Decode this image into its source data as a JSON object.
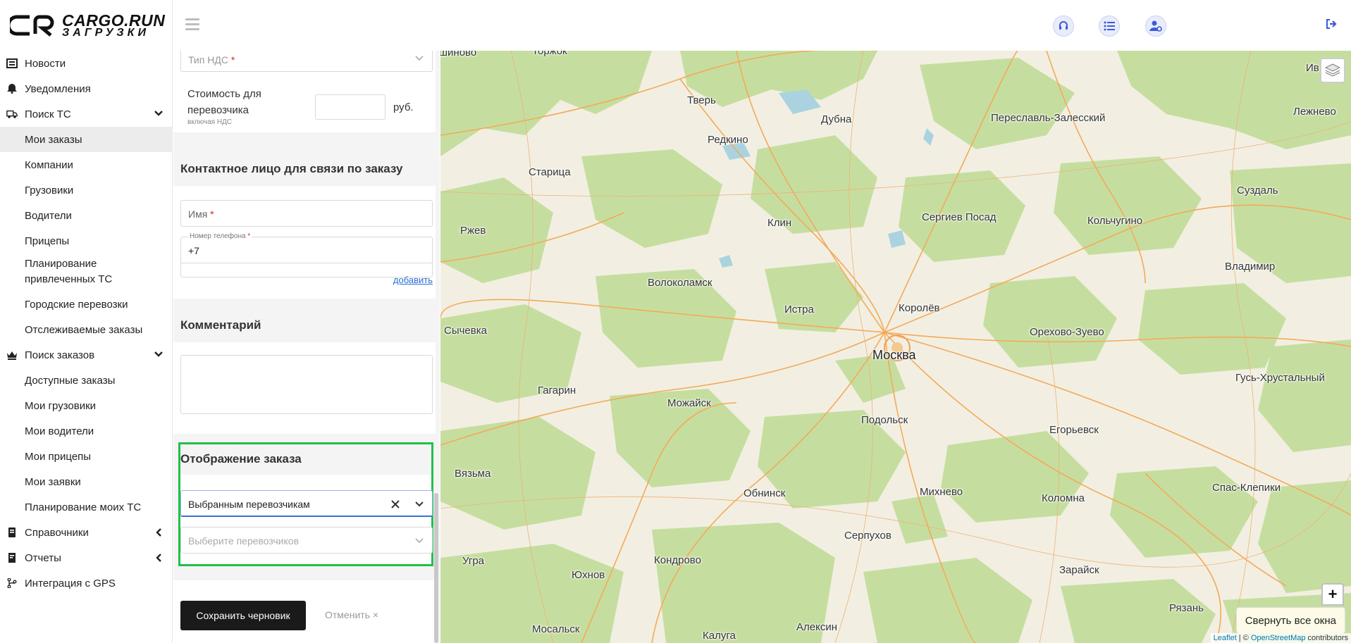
{
  "logo": {
    "line1": "CARGO.RUN",
    "line2": "ЗАГРУЗКИ"
  },
  "header": {
    "icons": [
      "headset-icon",
      "list-icon",
      "user-settings-icon"
    ],
    "logout_icon": "logout-icon"
  },
  "sidebar": {
    "items": [
      {
        "label": "Новости",
        "icon": "newspaper-icon"
      },
      {
        "label": "Уведомления",
        "icon": "bell-icon"
      },
      {
        "label": "Поиск ТС",
        "icon": "truck-icon",
        "chevron": "down"
      },
      {
        "label": "Мои заказы",
        "active": true
      },
      {
        "label": "Компании"
      },
      {
        "label": "Грузовики"
      },
      {
        "label": "Водители"
      },
      {
        "label": "Прицепы"
      },
      {
        "label": "Планирование привлеченных ТС"
      },
      {
        "label": "Городские перевозки"
      },
      {
        "label": "Отслеживаемые заказы"
      },
      {
        "label": "Поиск заказов",
        "icon": "crown-icon",
        "chevron": "down"
      },
      {
        "label": "Доступные заказы"
      },
      {
        "label": "Мои грузовики"
      },
      {
        "label": "Мои водители"
      },
      {
        "label": "Мои прицепы"
      },
      {
        "label": "Мои заявки"
      },
      {
        "label": "Планирование моих ТС"
      },
      {
        "label": "Справочники",
        "icon": "book-icon",
        "chevron": "left"
      },
      {
        "label": "Отчеты",
        "icon": "report-icon",
        "chevron": "left"
      },
      {
        "label": "Интеграция с GPS",
        "icon": "branch-icon"
      }
    ]
  },
  "form": {
    "vat_type_placeholder": "Тип НДС",
    "carrier_cost_label": "Стоимость для перевозчика",
    "carrier_cost_hint": "включая НДС",
    "carrier_cost_value": "",
    "currency": "руб.",
    "contact_title": "Контактное лицо для связи по заказу",
    "name_placeholder": "Имя",
    "phone_label": "Номер телефона",
    "phone_value": "+7",
    "add_link": "добавить",
    "comment_title": "Комментарий",
    "comment_value": "",
    "display_title": "Отображение заказа",
    "display_value": "Выбранным перевозчикам",
    "carriers_placeholder": "Выберите перевозчиков",
    "save_button": "Сохранить черновик",
    "cancel_button": "Отменить ×"
  },
  "map": {
    "cities": [
      {
        "name": "Тверь"
      },
      {
        "name": "Редкино"
      },
      {
        "name": "Дубна"
      },
      {
        "name": "Переславль-Залесский"
      },
      {
        "name": "Лежнево"
      },
      {
        "name": "Старица"
      },
      {
        "name": "Суздаль"
      },
      {
        "name": "Ржев"
      },
      {
        "name": "Клин"
      },
      {
        "name": "Сергиев Посад"
      },
      {
        "name": "Кольчугино"
      },
      {
        "name": "Владимир"
      },
      {
        "name": "Волоколамск"
      },
      {
        "name": "Истра"
      },
      {
        "name": "Королёв"
      },
      {
        "name": "Сычевка"
      },
      {
        "name": "Орехово-Зуево"
      },
      {
        "name": "Москва",
        "big": true
      },
      {
        "name": "Гусь-Хрустальный"
      },
      {
        "name": "Гагарин"
      },
      {
        "name": "Можайск"
      },
      {
        "name": "Подольск"
      },
      {
        "name": "Егорьевск"
      },
      {
        "name": "Вязьма"
      },
      {
        "name": "Обнинск"
      },
      {
        "name": "Михнево"
      },
      {
        "name": "Коломна"
      },
      {
        "name": "Спас-Клепики"
      },
      {
        "name": "Серпухов"
      },
      {
        "name": "Угра"
      },
      {
        "name": "Кондрово"
      },
      {
        "name": "Юхнов"
      },
      {
        "name": "Зарайск"
      },
      {
        "name": "Рязань"
      },
      {
        "name": "Мосальск"
      },
      {
        "name": "Калуга"
      },
      {
        "name": "Алексин"
      },
      {
        "name": "Ив"
      }
    ],
    "zoom_in": "+",
    "collapse_button": "Свернуть все окна",
    "attribution": {
      "leaflet": "Leaflet",
      "sep": " | © ",
      "osm": "OpenStreetMap",
      "tail": " contributors"
    }
  }
}
